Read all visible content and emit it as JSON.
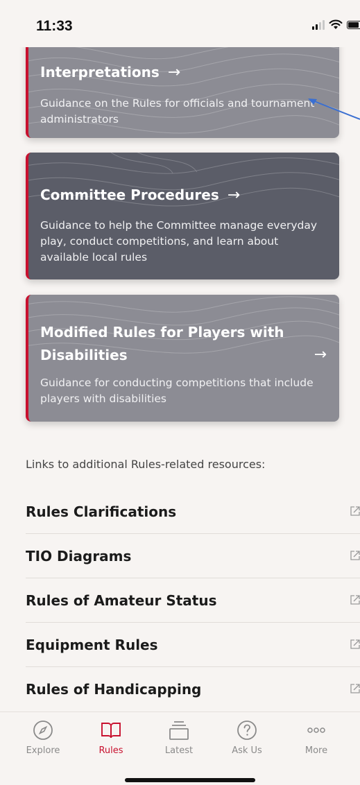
{
  "status": {
    "time": "11:33"
  },
  "cards": [
    {
      "title": "Interpretations",
      "arrow": "→",
      "desc": "Guidance on the Rules for officials and tournament administrators"
    },
    {
      "title": "Committee Procedures",
      "arrow": "→",
      "desc": "Guidance to help the Committee manage everyday play, conduct competitions, and learn about available local rules"
    },
    {
      "title_line1": "Modified Rules for Players with",
      "title_line2": "Disabilities",
      "arrow": "→",
      "desc": "Guidance for conducting competitions that include players with disabilities"
    }
  ],
  "links": {
    "heading": "Links to additional Rules-related resources:",
    "items": [
      {
        "label": "Rules Clarifications"
      },
      {
        "label": "TIO Diagrams"
      },
      {
        "label": "Rules of Amateur Status"
      },
      {
        "label": "Equipment Rules"
      },
      {
        "label": "Rules of Handicapping"
      }
    ]
  },
  "tabs": [
    {
      "label": "Explore",
      "icon": "compass-icon"
    },
    {
      "label": "Rules",
      "icon": "book-icon",
      "active": true
    },
    {
      "label": "Latest",
      "icon": "stack-icon"
    },
    {
      "label": "Ask Us",
      "icon": "question-icon"
    },
    {
      "label": "More",
      "icon": "more-dots-icon"
    }
  ],
  "colors": {
    "accent": "#c8102e",
    "card_light": "#8c8c94",
    "card_dark": "#5b5d68",
    "annotation": "#3a6fd1"
  }
}
